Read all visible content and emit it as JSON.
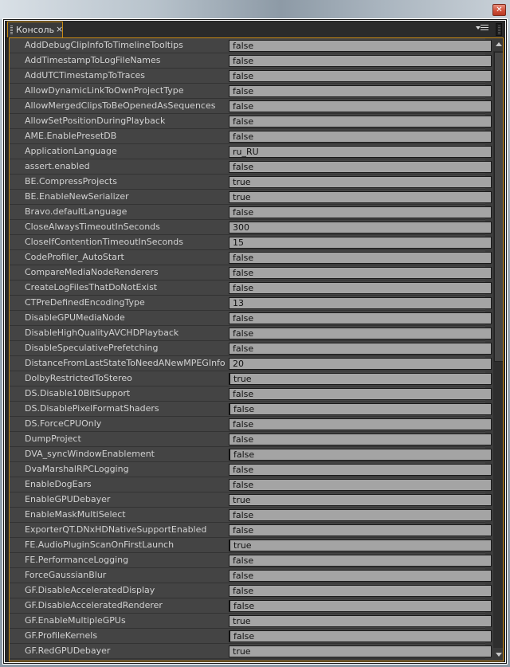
{
  "window": {
    "close_icon": "close-icon"
  },
  "panel": {
    "tab_label": "Консоль",
    "tab_close": "×",
    "menu_icon": "panel-menu-icon"
  },
  "scroll": {
    "position_fraction": 0.0,
    "visible_fraction": 0.52
  },
  "rows": [
    {
      "key": "AddDebugClipInfoToTimelineTooltips",
      "value": "false",
      "marked": false
    },
    {
      "key": "AddTimestampToLogFileNames",
      "value": "false",
      "marked": false
    },
    {
      "key": "AddUTCTimestampToTraces",
      "value": "false",
      "marked": false
    },
    {
      "key": "AllowDynamicLinkToOwnProjectType",
      "value": "false",
      "marked": false
    },
    {
      "key": "AllowMergedClipsToBeOpenedAsSequences",
      "value": "false",
      "marked": false
    },
    {
      "key": "AllowSetPositionDuringPlayback",
      "value": "false",
      "marked": false
    },
    {
      "key": "AME.EnablePresetDB",
      "value": "false",
      "marked": false
    },
    {
      "key": "ApplicationLanguage",
      "value": "ru_RU",
      "marked": false
    },
    {
      "key": "assert.enabled",
      "value": "false",
      "marked": false
    },
    {
      "key": "BE.CompressProjects",
      "value": "true",
      "marked": false
    },
    {
      "key": "BE.EnableNewSerializer",
      "value": "true",
      "marked": false
    },
    {
      "key": "Bravo.defaultLanguage",
      "value": "false",
      "marked": false
    },
    {
      "key": "CloseAlwaysTimeoutInSeconds",
      "value": "300",
      "marked": false
    },
    {
      "key": "CloseIfContentionTimeoutInSeconds",
      "value": "15",
      "marked": false
    },
    {
      "key": "CodeProfiler_AutoStart",
      "value": "false",
      "marked": false
    },
    {
      "key": "CompareMediaNodeRenderers",
      "value": "false",
      "marked": false
    },
    {
      "key": "CreateLogFilesThatDoNotExist",
      "value": "false",
      "marked": false
    },
    {
      "key": "CTPreDefinedEncodingType",
      "value": "13",
      "marked": false
    },
    {
      "key": "DisableGPUMediaNode",
      "value": "false",
      "marked": false
    },
    {
      "key": "DisableHighQualityAVCHDPlayback",
      "value": "false",
      "marked": false
    },
    {
      "key": "DisableSpeculativePrefetching",
      "value": "false",
      "marked": false
    },
    {
      "key": "DistanceFromLastStateToNeedANewMPEGInfo",
      "value": "20",
      "marked": false
    },
    {
      "key": "DolbyRestrictedToStereo",
      "value": "true",
      "marked": true
    },
    {
      "key": "DS.Disable10BitSupport",
      "value": "false",
      "marked": false
    },
    {
      "key": "DS.DisablePixelFormatShaders",
      "value": "false",
      "marked": true
    },
    {
      "key": "DS.ForceCPUOnly",
      "value": "false",
      "marked": false
    },
    {
      "key": "DumpProject",
      "value": "false",
      "marked": false
    },
    {
      "key": "DVA_syncWindowEnablement",
      "value": "false",
      "marked": true
    },
    {
      "key": "DvaMarshalRPCLogging",
      "value": "false",
      "marked": false
    },
    {
      "key": "EnableDogEars",
      "value": "false",
      "marked": false
    },
    {
      "key": "EnableGPUDebayer",
      "value": "true",
      "marked": false
    },
    {
      "key": "EnableMaskMultiSelect",
      "value": "false",
      "marked": false
    },
    {
      "key": "ExporterQT.DNxHDNativeSupportEnabled",
      "value": "false",
      "marked": false
    },
    {
      "key": "FE.AudioPluginScanOnFirstLaunch",
      "value": "true",
      "marked": true
    },
    {
      "key": "FE.PerformanceLogging",
      "value": "false",
      "marked": false
    },
    {
      "key": "ForceGaussianBlur",
      "value": "false",
      "marked": false
    },
    {
      "key": "GF.DisableAcceleratedDisplay",
      "value": "false",
      "marked": false
    },
    {
      "key": "GF.DisableAcceleratedRenderer",
      "value": "false",
      "marked": true
    },
    {
      "key": "GF.EnableMultipleGPUs",
      "value": "true",
      "marked": false
    },
    {
      "key": "GF.ProfileKernels",
      "value": "false",
      "marked": true
    },
    {
      "key": "GF.RedGPUDebayer",
      "value": "true",
      "marked": false
    }
  ]
}
